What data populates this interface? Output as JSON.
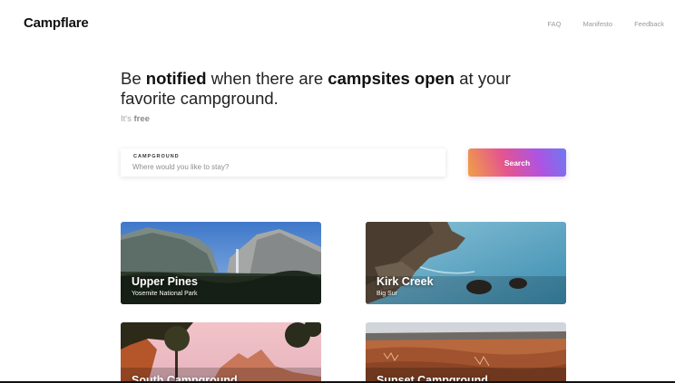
{
  "brand": {
    "logo": "Campflare"
  },
  "nav": {
    "items": [
      "FAQ",
      "Manifesto",
      "Feedback"
    ]
  },
  "hero": {
    "line1_pre": "Be ",
    "line1_b1": "notified",
    "line1_mid": " when there are ",
    "line1_b2": "campsites open",
    "line1_post": " at your",
    "line2": "favorite campground.",
    "sub_pre": "It's ",
    "sub_b": "free"
  },
  "search": {
    "label": "CAMPGROUND",
    "placeholder": "Where would you like to stay?",
    "value": "",
    "button": "Search"
  },
  "cards": [
    {
      "title": "Upper Pines",
      "subtitle": "Yosemite National Park"
    },
    {
      "title": "Kirk Creek",
      "subtitle": "Big Sur"
    },
    {
      "title": "South Campground",
      "subtitle": ""
    },
    {
      "title": "Sunset Campground",
      "subtitle": ""
    }
  ],
  "colors": {
    "button_gradient": [
      "#f0a045",
      "#e5558f",
      "#b053e0",
      "#6d79f2"
    ],
    "nav_text": "#9a9a9a",
    "sub_text": "#a5a5a5"
  }
}
